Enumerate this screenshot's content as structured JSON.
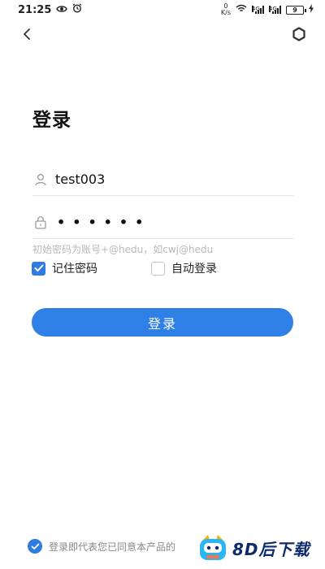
{
  "status_bar": {
    "time": "21:25",
    "net_speed_value": "0",
    "net_speed_unit": "K/s",
    "sim1_tag": "4G",
    "sim2_tag": "4G",
    "battery": "9"
  },
  "nav": {
    "back_icon": "chevron-left-icon",
    "settings_icon": "hexagon-settings-icon"
  },
  "title": "登录",
  "username": {
    "value": "test003",
    "icon": "user-icon"
  },
  "password": {
    "masked": "••••••",
    "icon": "lock-icon"
  },
  "hint": "初始密码为账号+@hedu，如cwj@hedu",
  "remember": {
    "label": "记住密码",
    "checked": true
  },
  "auto_login": {
    "label": "自动登录",
    "checked": false
  },
  "login_button": "登录",
  "agreement": {
    "text": "登录即代表您已同意本产品的",
    "checked": true
  },
  "watermark": {
    "text": "8D后下载"
  },
  "colors": {
    "primary": "#2f80e6",
    "checkbox": "#2f7ce0",
    "hint": "#b8b8b8",
    "divider": "#e5e5e5"
  }
}
